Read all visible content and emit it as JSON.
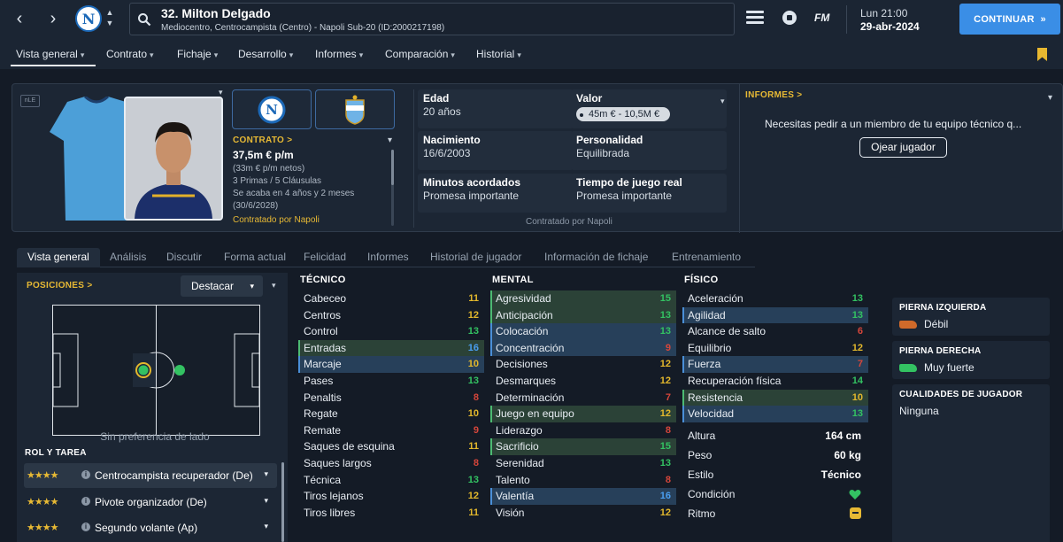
{
  "header": {
    "player_title": "32. Milton Delgado",
    "player_subtitle": "Mediocentro, Centrocampista (Centro) - Napoli Sub-20 (ID:2000217198)",
    "club_letter": "N",
    "fm_logo": "FM",
    "time": "Lun 21:00",
    "date": "29-abr-2024",
    "continue_label": "CONTINUAR",
    "continue_icon": "»"
  },
  "subnav": {
    "items": [
      "Vista general",
      "Contrato",
      "Fichaje",
      "Desarrollo",
      "Informes",
      "Comparación",
      "Historial"
    ]
  },
  "profile": {
    "nle": "nLE",
    "contract_title": "CONTRATO >",
    "wage": "37,5m € p/m",
    "net": "(33m € p/m netos)",
    "bonuses": "3 Primas / 5 Cláusulas",
    "expires": "Se acaba en 4 años y 2 meses",
    "expiry_date": "(30/6/2028)",
    "contracted_by": "Contratado por Napoli",
    "age_label": "Edad",
    "age": "20 años",
    "value_label": "Valor",
    "value": "45m € - 10,5M €",
    "birth_label": "Nacimiento",
    "birth": "16/6/2003",
    "personality_label": "Personalidad",
    "personality": "Equilibrada",
    "minutes_label": "Minutos acordados",
    "minutes": "Promesa importante",
    "playtime_label": "Tiempo de juego real",
    "playtime": "Promesa importante",
    "footer": "Contratado por Napoli",
    "reports_title": "INFORMES >",
    "reports_msg": "Necesitas pedir a un miembro de tu equipo técnico q...",
    "scout_button": "Ojear jugador"
  },
  "tabs": [
    "Vista general",
    "Análisis",
    "Discutir",
    "Forma actual",
    "Felicidad",
    "Informes",
    "Historial de jugador",
    "Información de fichaje",
    "Entrenamiento"
  ],
  "positions": {
    "title": "POSICIONES >",
    "highlight": "Destacar",
    "side_pref": "Sin preferencia de lado",
    "role_title": "ROL Y TAREA",
    "roles": [
      {
        "stars": "★★★★",
        "name": "Centrocampista recuperador (De)"
      },
      {
        "stars": "★★★★",
        "name": "Pivote organizador (De)"
      },
      {
        "stars": "★★★★",
        "name": "Segundo volante (Ap)"
      }
    ]
  },
  "technical": {
    "title": "TÉCNICO",
    "rows": [
      {
        "name": "Cabeceo",
        "value": "11",
        "color": "yellow",
        "hl": ""
      },
      {
        "name": "Centros",
        "value": "12",
        "color": "yellow",
        "hl": ""
      },
      {
        "name": "Control",
        "value": "13",
        "color": "green",
        "hl": ""
      },
      {
        "name": "Entradas",
        "value": "16",
        "color": "blue",
        "hl": "green"
      },
      {
        "name": "Marcaje",
        "value": "10",
        "color": "yellow",
        "hl": "blue"
      },
      {
        "name": "Pases",
        "value": "13",
        "color": "green",
        "hl": ""
      },
      {
        "name": "Penaltis",
        "value": "8",
        "color": "red",
        "hl": ""
      },
      {
        "name": "Regate",
        "value": "10",
        "color": "yellow",
        "hl": ""
      },
      {
        "name": "Remate",
        "value": "9",
        "color": "red",
        "hl": ""
      },
      {
        "name": "Saques de esquina",
        "value": "11",
        "color": "yellow",
        "hl": ""
      },
      {
        "name": "Saques largos",
        "value": "8",
        "color": "red",
        "hl": ""
      },
      {
        "name": "Técnica",
        "value": "13",
        "color": "green",
        "hl": ""
      },
      {
        "name": "Tiros lejanos",
        "value": "12",
        "color": "yellow",
        "hl": ""
      },
      {
        "name": "Tiros libres",
        "value": "11",
        "color": "yellow",
        "hl": ""
      }
    ]
  },
  "mental": {
    "title": "MENTAL",
    "rows": [
      {
        "name": "Agresividad",
        "value": "15",
        "color": "green",
        "hl": "green"
      },
      {
        "name": "Anticipación",
        "value": "13",
        "color": "green",
        "hl": "green"
      },
      {
        "name": "Colocación",
        "value": "13",
        "color": "green",
        "hl": "blue"
      },
      {
        "name": "Concentración",
        "value": "9",
        "color": "red",
        "hl": "blue"
      },
      {
        "name": "Decisiones",
        "value": "12",
        "color": "yellow",
        "hl": ""
      },
      {
        "name": "Desmarques",
        "value": "12",
        "color": "yellow",
        "hl": ""
      },
      {
        "name": "Determinación",
        "value": "7",
        "color": "red",
        "hl": ""
      },
      {
        "name": "Juego en equipo",
        "value": "12",
        "color": "yellow",
        "hl": "green"
      },
      {
        "name": "Liderazgo",
        "value": "8",
        "color": "red",
        "hl": ""
      },
      {
        "name": "Sacrificio",
        "value": "15",
        "color": "green",
        "hl": "green"
      },
      {
        "name": "Serenidad",
        "value": "13",
        "color": "green",
        "hl": ""
      },
      {
        "name": "Talento",
        "value": "8",
        "color": "red",
        "hl": ""
      },
      {
        "name": "Valentía",
        "value": "16",
        "color": "blue",
        "hl": "blue"
      },
      {
        "name": "Visión",
        "value": "12",
        "color": "yellow",
        "hl": ""
      }
    ]
  },
  "physical": {
    "title": "FÍSICO",
    "rows": [
      {
        "name": "Aceleración",
        "value": "13",
        "color": "green",
        "hl": ""
      },
      {
        "name": "Agilidad",
        "value": "13",
        "color": "green",
        "hl": "blue"
      },
      {
        "name": "Alcance de salto",
        "value": "6",
        "color": "red",
        "hl": ""
      },
      {
        "name": "Equilibrio",
        "value": "12",
        "color": "yellow",
        "hl": ""
      },
      {
        "name": "Fuerza",
        "value": "7",
        "color": "red",
        "hl": "blue"
      },
      {
        "name": "Recuperación física",
        "value": "14",
        "color": "green",
        "hl": ""
      },
      {
        "name": "Resistencia",
        "value": "10",
        "color": "yellow",
        "hl": "green"
      },
      {
        "name": "Velocidad",
        "value": "13",
        "color": "green",
        "hl": "blue"
      }
    ],
    "height_label": "Altura",
    "height": "164 cm",
    "weight_label": "Peso",
    "weight": "60 kg",
    "style_label": "Estilo",
    "style": "Técnico",
    "condition_label": "Condición",
    "sharpness_label": "Ritmo"
  },
  "feet": {
    "left_label": "PIERNA IZQUIERDA",
    "left_value": "Débil",
    "right_label": "PIERNA DERECHA",
    "right_value": "Muy fuerte",
    "qualities_label": "CUALIDADES DE JUGADOR",
    "qualities_value": "Ninguna"
  },
  "colors": {
    "accent": "#3a8ee6",
    "gold": "#e7b934",
    "green": "#33c262",
    "red": "#d6463b",
    "blue": "#4a9ef0"
  }
}
